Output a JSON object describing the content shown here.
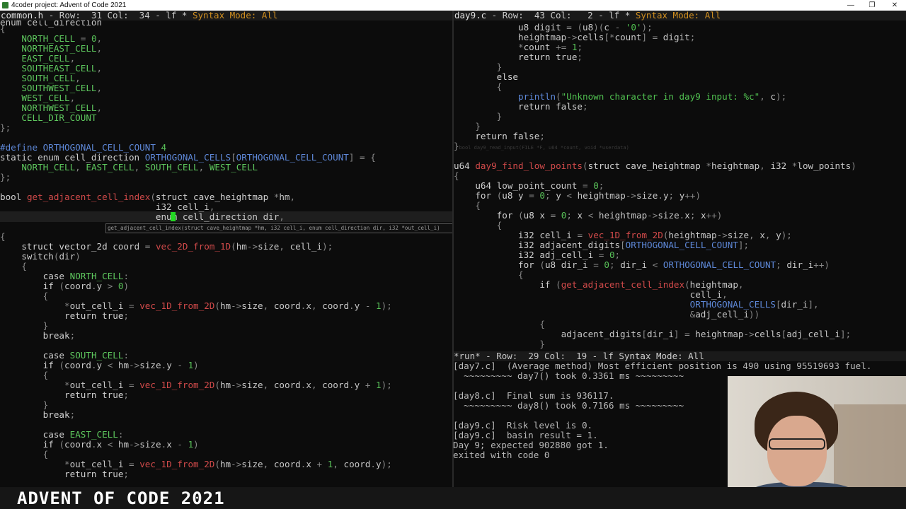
{
  "window": {
    "title": "4coder project: Advent of Code 2021",
    "minimize": "—",
    "maximize": "❐",
    "close": "✕"
  },
  "left_pane": {
    "filebar": {
      "filename": "common.h",
      "position": " - Row:  31 Col:  34 - lf * ",
      "mode": "Syntax Mode: All"
    },
    "tooltip": "get_adjacent_cell_index(struct cave_heightmap *hm, i32 cell_i, enum cell_direction dir, i32 *out_cell_i)"
  },
  "right_pane": {
    "filebar": {
      "filename": "day9.c",
      "position": " - Row:  43 Col:   2 - lf * ",
      "mode": "Syntax Mode: All"
    },
    "comment_line": "bool day9_read_input(FILE *F, u64 *count, void *userdata)"
  },
  "run_panel": {
    "filebar": {
      "filename": "*run*",
      "position": " - Row:  29 Col:  19 - lf ",
      "mode": "Syntax Mode: All"
    },
    "output": [
      "[day7.c]  (Average method) Most efficient position is 490 using 95519693 fuel.",
      "  ~~~~~~~~~ day7() took 0.3361 ms ~~~~~~~~~",
      "",
      "[day8.c]  Final sum is 936117.",
      "  ~~~~~~~~~ day8() took 0.7166 ms ~~~~~~~~~",
      "",
      "[day9.c]  Risk level is 0.",
      "[day9.c]  basin result = 1.",
      "Day 9; expected 902880 got 1.",
      "exited with code 0"
    ]
  },
  "banner": {
    "text": "ADVENT OF CODE 2021"
  },
  "colors": {
    "background": "#0c0c0c",
    "cursor": "#22d822",
    "filebar_mode": "#d08f20",
    "macro": "#5e88d8",
    "function": "#d14a4a",
    "number": "#58c058"
  }
}
